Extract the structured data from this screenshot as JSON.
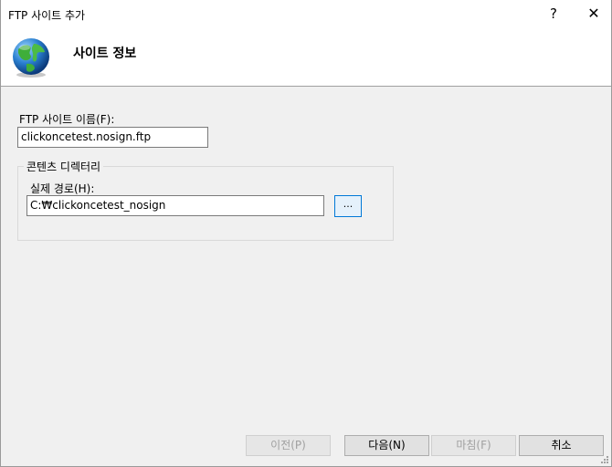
{
  "window": {
    "title": "FTP 사이트 추가",
    "help_label": "?",
    "close_label": "✕"
  },
  "header": {
    "title": "사이트 정보",
    "icon": "globe-icon"
  },
  "site_name": {
    "label": "FTP 사이트 이름(F):",
    "value": "clickoncetest.nosign.ftp"
  },
  "content_directory": {
    "group_title": "콘텐츠 디렉터리",
    "physical_path_label": "실제 경로(H):",
    "physical_path_value": "C:₩clickoncetest_nosign",
    "browse_label": "..."
  },
  "buttons": {
    "previous": "이전(P)",
    "next": "다음(N)",
    "finish": "마침(F)",
    "cancel": "취소"
  },
  "colors": {
    "accent": "#0078d7",
    "header_bg": "#ffffff",
    "body_bg": "#f0f0f0"
  }
}
